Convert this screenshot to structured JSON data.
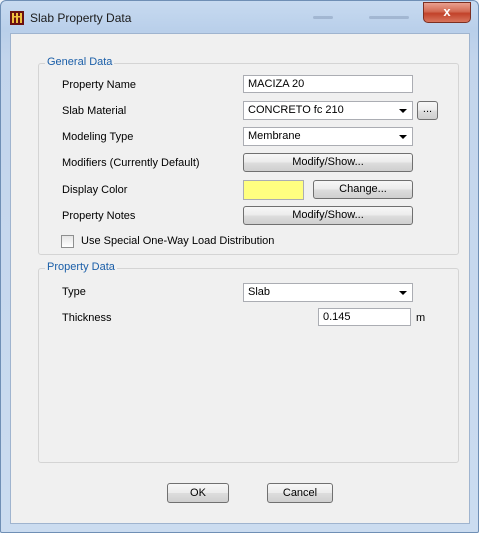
{
  "window": {
    "title": "Slab Property Data",
    "close_glyph": "x"
  },
  "general": {
    "group_title": "General Data",
    "property_name_label": "Property Name",
    "property_name_value": "MACIZA 20",
    "slab_material_label": "Slab Material",
    "slab_material_value": "CONCRETO fc 210",
    "more_button": "...",
    "modeling_type_label": "Modeling Type",
    "modeling_type_value": "Membrane",
    "modifiers_label": "Modifiers (Currently Default)",
    "modifiers_button": "Modify/Show...",
    "display_color_label": "Display Color",
    "display_color_value": "#ffff80",
    "change_button": "Change...",
    "notes_label": "Property Notes",
    "notes_button": "Modify/Show...",
    "one_way_label": "Use Special One-Way Load Distribution",
    "one_way_checked": false
  },
  "property": {
    "group_title": "Property Data",
    "type_label": "Type",
    "type_value": "Slab",
    "thickness_label": "Thickness",
    "thickness_value": "0.145",
    "thickness_unit": "m"
  },
  "footer": {
    "ok": "OK",
    "cancel": "Cancel"
  },
  "icons": {
    "app": "etabs-icon",
    "close": "close-icon",
    "dropdown": "chevron-down-icon"
  }
}
